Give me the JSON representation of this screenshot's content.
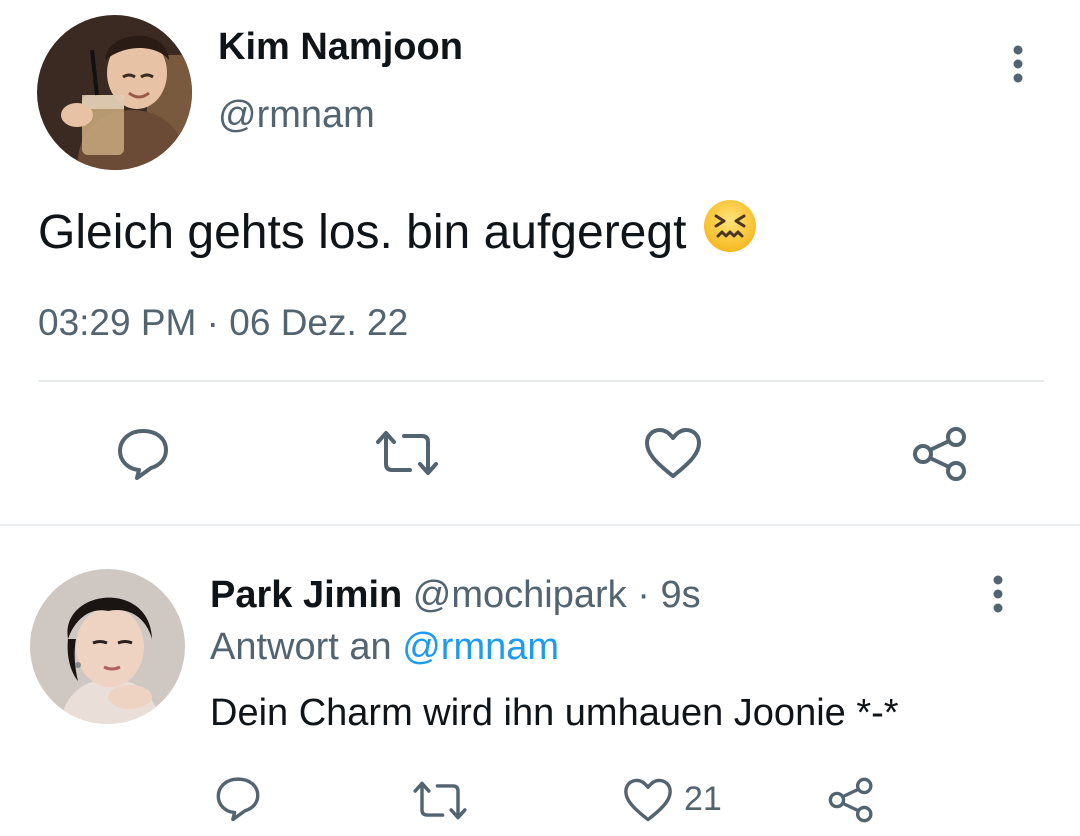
{
  "tweet": {
    "author_name": "Kim Namjoon",
    "author_handle": "@rmnam",
    "text": "Gleich gehts los. bin aufgeregt",
    "emoji": "confounded-face",
    "time": "03:29 PM",
    "dot": "·",
    "date": "06 Dez. 22",
    "actions": [
      "reply",
      "retweet",
      "like",
      "share"
    ]
  },
  "reply": {
    "author_name": "Park Jimin",
    "author_handle": "@mochipark",
    "dot": "·",
    "age": "9s",
    "reply_prefix": "Antwort an",
    "reply_mention": "@rmnam",
    "text": "Dein Charm wird ihn umhauen Joonie *-*",
    "like_count": "21",
    "actions": [
      "reply",
      "retweet",
      "like",
      "share"
    ]
  },
  "colors": {
    "text": "#0f1419",
    "secondary": "#536471",
    "link": "#1d9bf0",
    "divider": "#e6e9ec"
  }
}
